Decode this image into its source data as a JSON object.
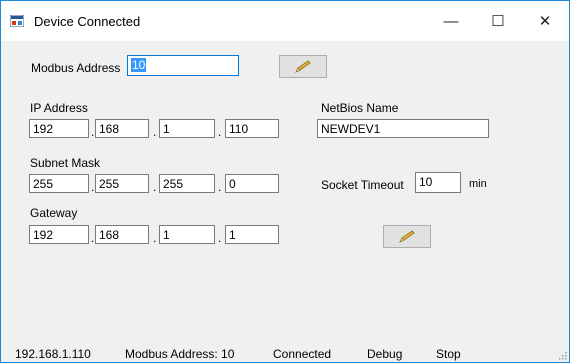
{
  "window": {
    "title": "Device Connected",
    "minimize_glyph": "—",
    "maximize_glyph": "☐",
    "close_glyph": "✕"
  },
  "modbus": {
    "label": "Modbus Address",
    "value": "10"
  },
  "ip": {
    "label": "IP Address",
    "octets": [
      "192",
      "168",
      "1",
      "110"
    ]
  },
  "subnet": {
    "label": "Subnet Mask",
    "octets": [
      "255",
      "255",
      "255",
      "0"
    ]
  },
  "gateway": {
    "label": "Gateway",
    "octets": [
      "192",
      "168",
      "1",
      "1"
    ]
  },
  "netbios": {
    "label": "NetBios Name",
    "value": "NEWDEV1"
  },
  "socket_timeout": {
    "label": "Socket Timeout",
    "value": "10",
    "unit": "min"
  },
  "separator": ".",
  "icons": {
    "app": "app-window-icon",
    "edit": "pencil-icon"
  },
  "status": {
    "ip": "192.168.1.110",
    "modbus": "Modbus Address: 10",
    "state": "Connected",
    "debug": "Debug",
    "stop": "Stop"
  },
  "colors": {
    "accent": "#0078d7",
    "selection": "#3399ff",
    "pencil": "#e8b93a"
  }
}
